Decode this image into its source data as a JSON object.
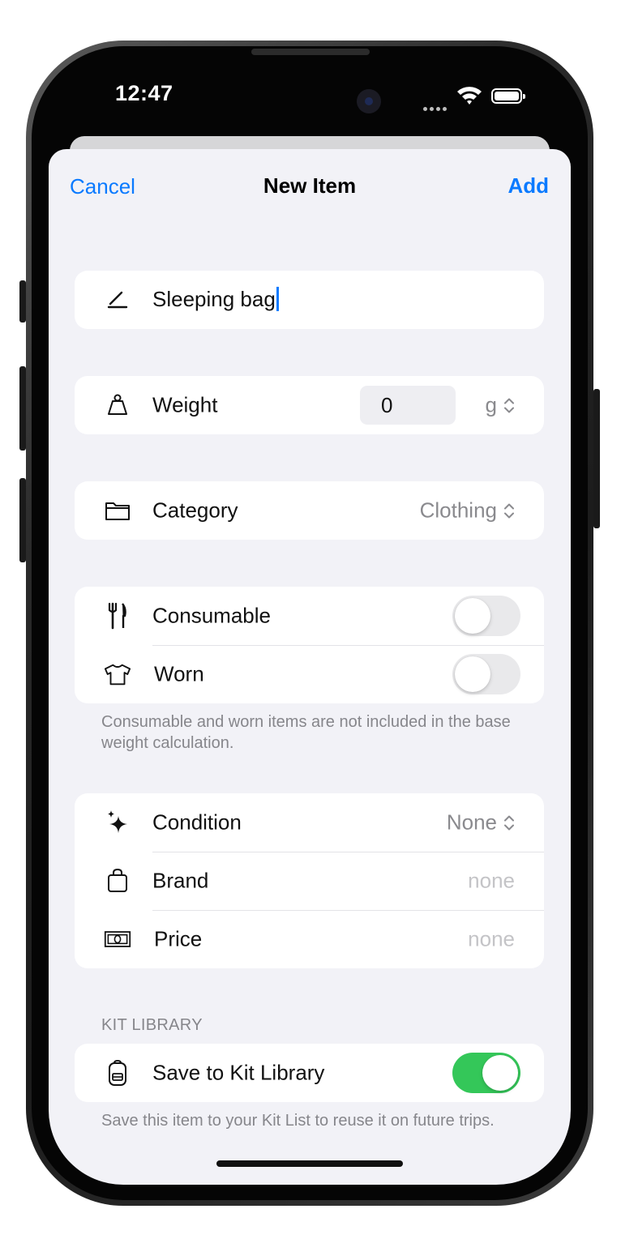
{
  "status_bar": {
    "time": "12:47"
  },
  "nav": {
    "cancel_label": "Cancel",
    "title": "New Item",
    "add_label": "Add"
  },
  "name_field": {
    "value": "Sleeping bag"
  },
  "weight": {
    "label": "Weight",
    "value": "0",
    "unit": "g"
  },
  "category": {
    "label": "Category",
    "value": "Clothing"
  },
  "flags": {
    "consumable": {
      "label": "Consumable",
      "on": false
    },
    "worn": {
      "label": "Worn",
      "on": false
    },
    "footnote": "Consumable and worn items are not included in the base weight calculation."
  },
  "details": {
    "condition": {
      "label": "Condition",
      "value": "None"
    },
    "brand": {
      "label": "Brand",
      "placeholder": "none"
    },
    "price": {
      "label": "Price",
      "placeholder": "none"
    }
  },
  "kit_library": {
    "header": "KIT LIBRARY",
    "save_label": "Save to Kit Library",
    "save_on": true,
    "footnote": "Save this item to your Kit List to reuse it on future trips."
  },
  "colors": {
    "accent": "#0a7aff",
    "toggle_on": "#34c759",
    "background": "#f2f2f7"
  }
}
